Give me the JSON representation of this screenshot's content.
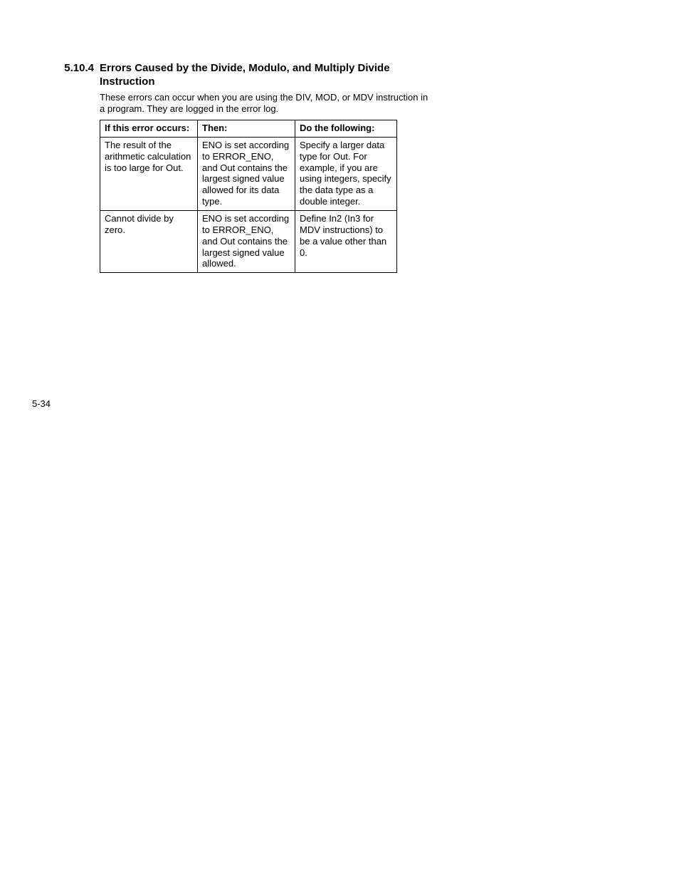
{
  "section": {
    "number": "5.10.4",
    "title": "Errors Caused by the Divide, Modulo, and Multiply Divide Instruction"
  },
  "intro": "These errors can occur when you are using the DIV, MOD, or MDV instruction in a program. They are logged in the error log.",
  "table": {
    "headers": {
      "col1": "If this error occurs:",
      "col2": "Then:",
      "col3": "Do the following:"
    },
    "rows": [
      {
        "col1": "The result of the arithmetic calculation is too large for Out.",
        "col2": "ENO is set according to ERROR_ENO, and Out contains the largest signed value allowed for its data type.",
        "col3": "Specify a larger data type for Out. For example, if you are using integers, specify the data type as a double integer."
      },
      {
        "col1": "Cannot divide by zero.",
        "col2": "ENO is set according to ERROR_ENO, and Out contains the largest signed value allowed.",
        "col3": "Define In2 (In3 for MDV instructions) to be a value other than 0."
      }
    ]
  },
  "page_number": "5-34"
}
